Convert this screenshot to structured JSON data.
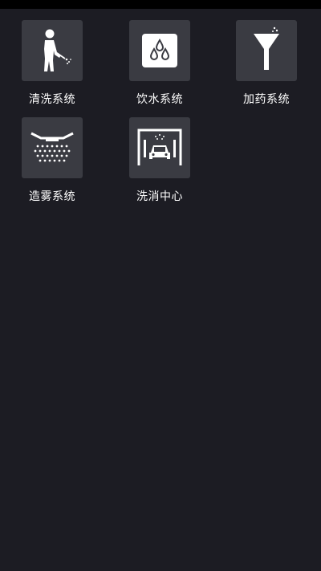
{
  "menu": {
    "items": [
      {
        "label": "清洗系统",
        "icon": "washing-person-icon"
      },
      {
        "label": "饮水系统",
        "icon": "water-drops-icon"
      },
      {
        "label": "加药系统",
        "icon": "medicine-funnel-icon"
      },
      {
        "label": "造雾系统",
        "icon": "mist-spray-icon"
      },
      {
        "label": "洗消中心",
        "icon": "car-wash-icon"
      }
    ]
  },
  "colors": {
    "background": "#1c1c23",
    "tile": "#3a3b42",
    "status_bar": "#000000",
    "text": "#ffffff"
  }
}
